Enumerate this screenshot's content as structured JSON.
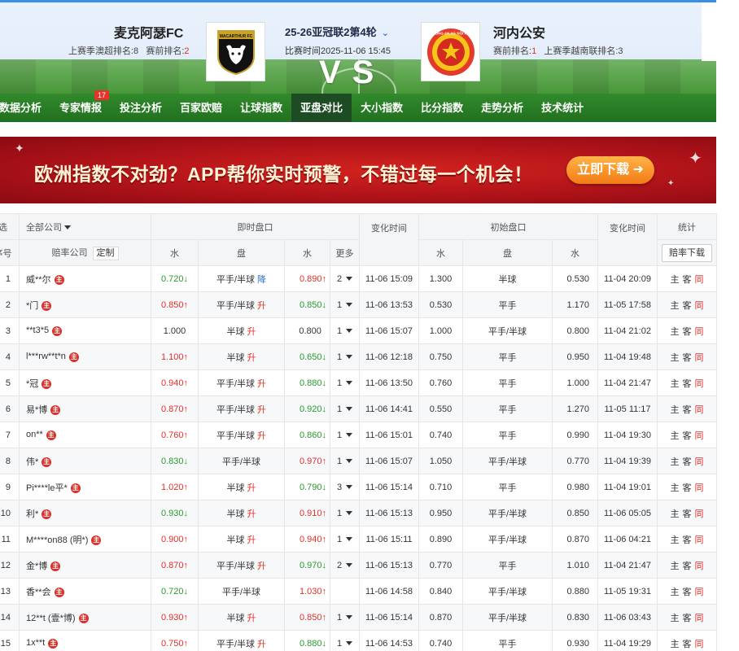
{
  "header": {
    "home": {
      "name": "麦克阿瑟FC",
      "last_rank_label": "上赛季澳超排名:8",
      "cur_rank_label": "赛前排名:",
      "cur_rank": "2",
      "logo_text": "MACARTHUR FC"
    },
    "away": {
      "name": "河内公安",
      "cur_rank_label": "赛前排名:",
      "cur_rank": "1",
      "last_rank_label": "上赛季越南联排名:3",
      "logo_text": "CÔNG AN HÀ NỘI FC"
    },
    "round": "25-26亚冠联2第4轮",
    "match_time": "比赛时间2025-11-06 15:45",
    "vs": "VS"
  },
  "nav": {
    "items": [
      {
        "label": "数据分析"
      },
      {
        "label": "专家情报",
        "badge": "17"
      },
      {
        "label": "投注分析"
      },
      {
        "label": "百家欧赔"
      },
      {
        "label": "让球指数"
      },
      {
        "label": "亚盘对比",
        "active": true
      },
      {
        "label": "大小指数"
      },
      {
        "label": "比分指数"
      },
      {
        "label": "走势分析"
      },
      {
        "label": "技术统计"
      }
    ]
  },
  "banner": {
    "text": "欧洲指数不对劲？APP帮你实时预警，不错过每一个机会！",
    "button": "立即下载 ➜"
  },
  "table": {
    "header1": {
      "select": "选",
      "all_companies": "全部公司",
      "live": "即时盘口",
      "change_time": "变化时间",
      "initial": "初始盘口",
      "change_time2": "变化时间",
      "stats": "统计"
    },
    "header2": {
      "no": "序号",
      "company": "赔率公司",
      "custom": "定制",
      "water1": "水",
      "handicap": "盘",
      "water2": "水",
      "more": "更多",
      "iwater1": "水",
      "ihandicap": "盘",
      "iwater2": "水",
      "download": "赔率下载"
    },
    "stat_labels": {
      "home": "主",
      "away": "客",
      "same": "同"
    },
    "rows": [
      {
        "no": "1",
        "company": "威**尔",
        "w1": "0.720",
        "w1d": "down",
        "hc": "平手/半球",
        "hcc": "降",
        "w2": "0.890",
        "w2d": "up",
        "more": "2",
        "t": "11-06 15:09",
        "iw1": "1.300",
        "ihc": "半球",
        "iw2": "0.530",
        "it": "11-04 20:09"
      },
      {
        "no": "2",
        "company": "*门",
        "w1": "0.850",
        "w1d": "up",
        "hc": "平手/半球",
        "hcc": "升",
        "w2": "0.850",
        "w2d": "down",
        "more": "1",
        "t": "11-06 13:53",
        "iw1": "0.530",
        "ihc": "平手",
        "iw2": "1.170",
        "it": "11-05 17:58"
      },
      {
        "no": "3",
        "company": "**t3*5",
        "w1": "1.000",
        "w1d": "",
        "hc": "半球",
        "hcc": "升",
        "w2": "0.800",
        "w2d": "",
        "more": "1",
        "t": "11-06 15:07",
        "iw1": "1.000",
        "ihc": "平手/半球",
        "iw2": "0.800",
        "it": "11-04 21:02"
      },
      {
        "no": "4",
        "company": "l***rw**t*n",
        "w1": "1.100",
        "w1d": "up",
        "hc": "半球",
        "hcc": "升",
        "w2": "0.650",
        "w2d": "down",
        "more": "1",
        "t": "11-06 12:18",
        "iw1": "0.750",
        "ihc": "平手",
        "iw2": "0.950",
        "it": "11-04 19:48"
      },
      {
        "no": "5",
        "company": "*冠",
        "w1": "0.940",
        "w1d": "up",
        "hc": "平手/半球",
        "hcc": "升",
        "w2": "0.880",
        "w2d": "down",
        "more": "1",
        "t": "11-06 13:50",
        "iw1": "0.760",
        "ihc": "平手",
        "iw2": "1.000",
        "it": "11-04 21:47"
      },
      {
        "no": "6",
        "company": "易*博",
        "w1": "0.870",
        "w1d": "up",
        "hc": "平手/半球",
        "hcc": "升",
        "w2": "0.920",
        "w2d": "down",
        "more": "1",
        "t": "11-06 14:41",
        "iw1": "0.550",
        "ihc": "平手",
        "iw2": "1.270",
        "it": "11-05 11:17"
      },
      {
        "no": "7",
        "company": "on**",
        "w1": "0.760",
        "w1d": "up",
        "hc": "平手/半球",
        "hcc": "升",
        "w2": "0.860",
        "w2d": "down",
        "more": "1",
        "t": "11-06 15:01",
        "iw1": "0.740",
        "ihc": "平手",
        "iw2": "0.990",
        "it": "11-04 19:30"
      },
      {
        "no": "8",
        "company": "伟*",
        "w1": "0.830",
        "w1d": "down",
        "hc": "平手/半球",
        "hcc": "",
        "w2": "0.970",
        "w2d": "up",
        "more": "1",
        "t": "11-06 15:07",
        "iw1": "1.050",
        "ihc": "平手/半球",
        "iw2": "0.770",
        "it": "11-04 19:39"
      },
      {
        "no": "9",
        "company": "Pi****le平*",
        "w1": "1.020",
        "w1d": "up",
        "hc": "半球",
        "hcc": "升",
        "w2": "0.790",
        "w2d": "down",
        "more": "3",
        "t": "11-06 15:14",
        "iw1": "0.710",
        "ihc": "平手",
        "iw2": "0.980",
        "it": "11-04 19:01"
      },
      {
        "no": "10",
        "company": "利*",
        "w1": "0.930",
        "w1d": "down",
        "hc": "半球",
        "hcc": "升",
        "w2": "0.910",
        "w2d": "up",
        "more": "1",
        "t": "11-06 15:13",
        "iw1": "0.950",
        "ihc": "平手/半球",
        "iw2": "0.850",
        "it": "11-06 05:05"
      },
      {
        "no": "11",
        "company": "M****on88 (明*)",
        "w1": "0.900",
        "w1d": "up",
        "hc": "半球",
        "hcc": "升",
        "w2": "0.940",
        "w2d": "up",
        "more": "1",
        "t": "11-06 15:11",
        "iw1": "0.890",
        "ihc": "平手/半球",
        "iw2": "0.870",
        "it": "11-06 04:21"
      },
      {
        "no": "12",
        "company": "金*博",
        "w1": "0.870",
        "w1d": "up",
        "hc": "平手/半球",
        "hcc": "升",
        "w2": "0.970",
        "w2d": "down",
        "more": "2",
        "t": "11-06 15:13",
        "iw1": "0.770",
        "ihc": "平手",
        "iw2": "1.010",
        "it": "11-04 21:47"
      },
      {
        "no": "13",
        "company": "香**会",
        "w1": "0.720",
        "w1d": "down",
        "hc": "平手/半球",
        "hcc": "",
        "w2": "1.030",
        "w2d": "up",
        "more": "",
        "t": "11-06 14:58",
        "iw1": "0.840",
        "ihc": "平手/半球",
        "iw2": "0.880",
        "it": "11-05 19:31"
      },
      {
        "no": "14",
        "company": "12**t (壹*博)",
        "w1": "0.930",
        "w1d": "up",
        "hc": "半球",
        "hcc": "升",
        "w2": "0.850",
        "w2d": "up",
        "more": "1",
        "t": "11-06 15:14",
        "iw1": "0.870",
        "ihc": "平手/半球",
        "iw2": "0.830",
        "it": "11-06 03:43"
      },
      {
        "no": "15",
        "company": "1x**t",
        "w1": "0.750",
        "w1d": "up",
        "hc": "平手/半球",
        "hcc": "升",
        "w2": "0.880",
        "w2d": "down",
        "more": "1",
        "t": "11-06 14:53",
        "iw1": "0.740",
        "ihc": "平手",
        "iw2": "0.930",
        "it": "11-04 19:29"
      }
    ]
  }
}
